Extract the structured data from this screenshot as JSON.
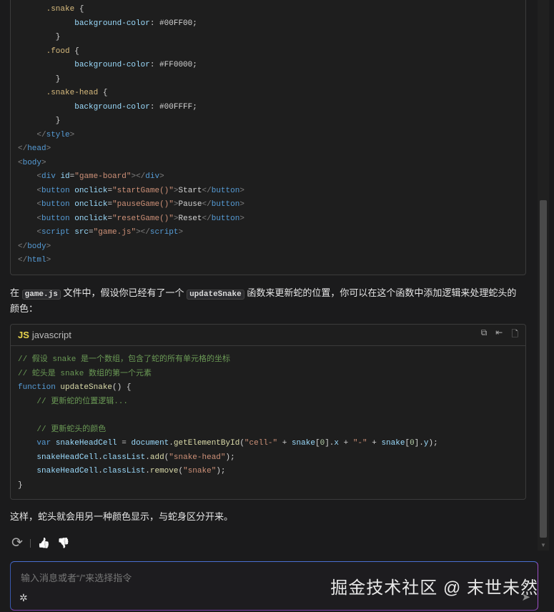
{
  "code_block_1": {
    "lines": [
      [
        [
          "",
          "      "
        ],
        [
          "t-sel",
          ".snake"
        ],
        [
          "",
          " {"
        ]
      ],
      [
        [
          "",
          "            "
        ],
        [
          "t-prop",
          "background-color"
        ],
        [
          "",
          ": #00FF00;"
        ]
      ],
      [
        [
          "",
          "        }"
        ]
      ],
      [
        [
          "",
          "      "
        ],
        [
          "t-sel",
          ".food"
        ],
        [
          "",
          " {"
        ]
      ],
      [
        [
          "",
          "            "
        ],
        [
          "t-prop",
          "background-color"
        ],
        [
          "",
          ": #FF0000;"
        ]
      ],
      [
        [
          "",
          "        }"
        ]
      ],
      [
        [
          "",
          "      "
        ],
        [
          "t-sel",
          ".snake-head"
        ],
        [
          "",
          " {"
        ]
      ],
      [
        [
          "",
          "            "
        ],
        [
          "t-prop",
          "background-color"
        ],
        [
          "",
          ": #00FFFF;"
        ]
      ],
      [
        [
          "",
          "        }"
        ]
      ],
      [
        [
          "",
          "    "
        ],
        [
          "t-br",
          "</"
        ],
        [
          "t-tag",
          "style"
        ],
        [
          "t-br",
          ">"
        ]
      ],
      [
        [
          "t-br",
          "</"
        ],
        [
          "t-tag",
          "head"
        ],
        [
          "t-br",
          ">"
        ]
      ],
      [
        [
          "t-br",
          "<"
        ],
        [
          "t-tag",
          "body"
        ],
        [
          "t-br",
          ">"
        ]
      ],
      [
        [
          "",
          "    "
        ],
        [
          "t-br",
          "<"
        ],
        [
          "t-tag",
          "div"
        ],
        [
          "",
          " "
        ],
        [
          "t-attr",
          "id"
        ],
        [
          "",
          "="
        ],
        [
          "t-str",
          "\"game-board\""
        ],
        [
          "t-br",
          "></"
        ],
        [
          "t-tag",
          "div"
        ],
        [
          "t-br",
          ">"
        ]
      ],
      [
        [
          "",
          "    "
        ],
        [
          "t-br",
          "<"
        ],
        [
          "t-tag",
          "button"
        ],
        [
          "",
          " "
        ],
        [
          "t-attr",
          "onclick"
        ],
        [
          "",
          "="
        ],
        [
          "t-str",
          "\"startGame()\""
        ],
        [
          "t-br",
          ">"
        ],
        [
          "",
          "Start"
        ],
        [
          "t-br",
          "</"
        ],
        [
          "t-tag",
          "button"
        ],
        [
          "t-br",
          ">"
        ]
      ],
      [
        [
          "",
          "    "
        ],
        [
          "t-br",
          "<"
        ],
        [
          "t-tag",
          "button"
        ],
        [
          "",
          " "
        ],
        [
          "t-attr",
          "onclick"
        ],
        [
          "",
          "="
        ],
        [
          "t-str",
          "\"pauseGame()\""
        ],
        [
          "t-br",
          ">"
        ],
        [
          "",
          "Pause"
        ],
        [
          "t-br",
          "</"
        ],
        [
          "t-tag",
          "button"
        ],
        [
          "t-br",
          ">"
        ]
      ],
      [
        [
          "",
          "    "
        ],
        [
          "t-br",
          "<"
        ],
        [
          "t-tag",
          "button"
        ],
        [
          "",
          " "
        ],
        [
          "t-attr",
          "onclick"
        ],
        [
          "",
          "="
        ],
        [
          "t-str",
          "\"resetGame()\""
        ],
        [
          "t-br",
          ">"
        ],
        [
          "",
          "Reset"
        ],
        [
          "t-br",
          "</"
        ],
        [
          "t-tag",
          "button"
        ],
        [
          "t-br",
          ">"
        ]
      ],
      [
        [
          "",
          "    "
        ],
        [
          "t-br",
          "<"
        ],
        [
          "t-tag",
          "script"
        ],
        [
          "",
          " "
        ],
        [
          "t-attr",
          "src"
        ],
        [
          "",
          "="
        ],
        [
          "t-str",
          "\"game.js\""
        ],
        [
          "t-br",
          "></"
        ],
        [
          "t-tag",
          "script"
        ],
        [
          "t-br",
          ">"
        ]
      ],
      [
        [
          "t-br",
          "</"
        ],
        [
          "t-tag",
          "body"
        ],
        [
          "t-br",
          ">"
        ]
      ],
      [
        [
          "t-br",
          "</"
        ],
        [
          "t-tag",
          "html"
        ],
        [
          "t-br",
          ">"
        ]
      ]
    ]
  },
  "paragraph_1": {
    "before": "在 ",
    "code1": "game.js",
    "middle": " 文件中，假设你已经有了一个 ",
    "code2": "updateSnake",
    "after": " 函数来更新蛇的位置，你可以在这个函数中添加逻辑来处理蛇头的颜色："
  },
  "code_block_2": {
    "badge": "JS",
    "language": "javascript",
    "actions": [
      "copy",
      "insert",
      "new-file"
    ],
    "lines": [
      [
        [
          "t-cm",
          "// 假设 snake 是一个数组，包含了蛇的所有单元格的坐标"
        ]
      ],
      [
        [
          "t-cm",
          "// 蛇头是 snake 数组的第一个元素"
        ]
      ],
      [
        [
          "t-kw",
          "function"
        ],
        [
          "",
          " "
        ],
        [
          "t-fn",
          "updateSnake"
        ],
        [
          "",
          "() {"
        ]
      ],
      [
        [
          "",
          "    "
        ],
        [
          "t-cm",
          "// 更新蛇的位置逻辑..."
        ]
      ],
      [
        [
          "",
          ""
        ]
      ],
      [
        [
          "",
          "    "
        ],
        [
          "t-cm",
          "// 更新蛇头的颜色"
        ]
      ],
      [
        [
          "",
          "    "
        ],
        [
          "t-kw",
          "var"
        ],
        [
          "",
          " "
        ],
        [
          "t-var",
          "snakeHeadCell"
        ],
        [
          "",
          " = "
        ],
        [
          "t-var",
          "document"
        ],
        [
          "",
          "."
        ],
        [
          "t-fn",
          "getElementById"
        ],
        [
          "",
          "("
        ],
        [
          "t-str",
          "\"cell-\""
        ],
        [
          "",
          " + "
        ],
        [
          "t-var",
          "snake"
        ],
        [
          "",
          "["
        ],
        [
          "t-num",
          "0"
        ],
        [
          "",
          "]."
        ],
        [
          "t-var",
          "x"
        ],
        [
          "",
          " + "
        ],
        [
          "t-str",
          "\"-\""
        ],
        [
          "",
          " + "
        ],
        [
          "t-var",
          "snake"
        ],
        [
          "",
          "["
        ],
        [
          "t-num",
          "0"
        ],
        [
          "",
          "]."
        ],
        [
          "t-var",
          "y"
        ],
        [
          "",
          ");"
        ]
      ],
      [
        [
          "",
          "    "
        ],
        [
          "t-var",
          "snakeHeadCell"
        ],
        [
          "",
          "."
        ],
        [
          "t-var",
          "classList"
        ],
        [
          "",
          "."
        ],
        [
          "t-fn",
          "add"
        ],
        [
          "",
          "("
        ],
        [
          "t-str",
          "\"snake-head\""
        ],
        [
          "",
          ");"
        ]
      ],
      [
        [
          "",
          "    "
        ],
        [
          "t-var",
          "snakeHeadCell"
        ],
        [
          "",
          "."
        ],
        [
          "t-var",
          "classList"
        ],
        [
          "",
          "."
        ],
        [
          "t-fn",
          "remove"
        ],
        [
          "",
          "("
        ],
        [
          "t-str",
          "\"snake\""
        ],
        [
          "",
          ");"
        ]
      ],
      [
        [
          "",
          "}"
        ]
      ]
    ]
  },
  "paragraph_2": "这样，蛇头就会用另一种颜色显示，与蛇身区分开来。",
  "feedback": {
    "regenerate": "⟳",
    "like": "👍",
    "dislike": "👎"
  },
  "input": {
    "placeholder": "输入消息或者“/”来选择指令",
    "value": ""
  },
  "watermark": "掘金技术社区 @ 末世未然"
}
